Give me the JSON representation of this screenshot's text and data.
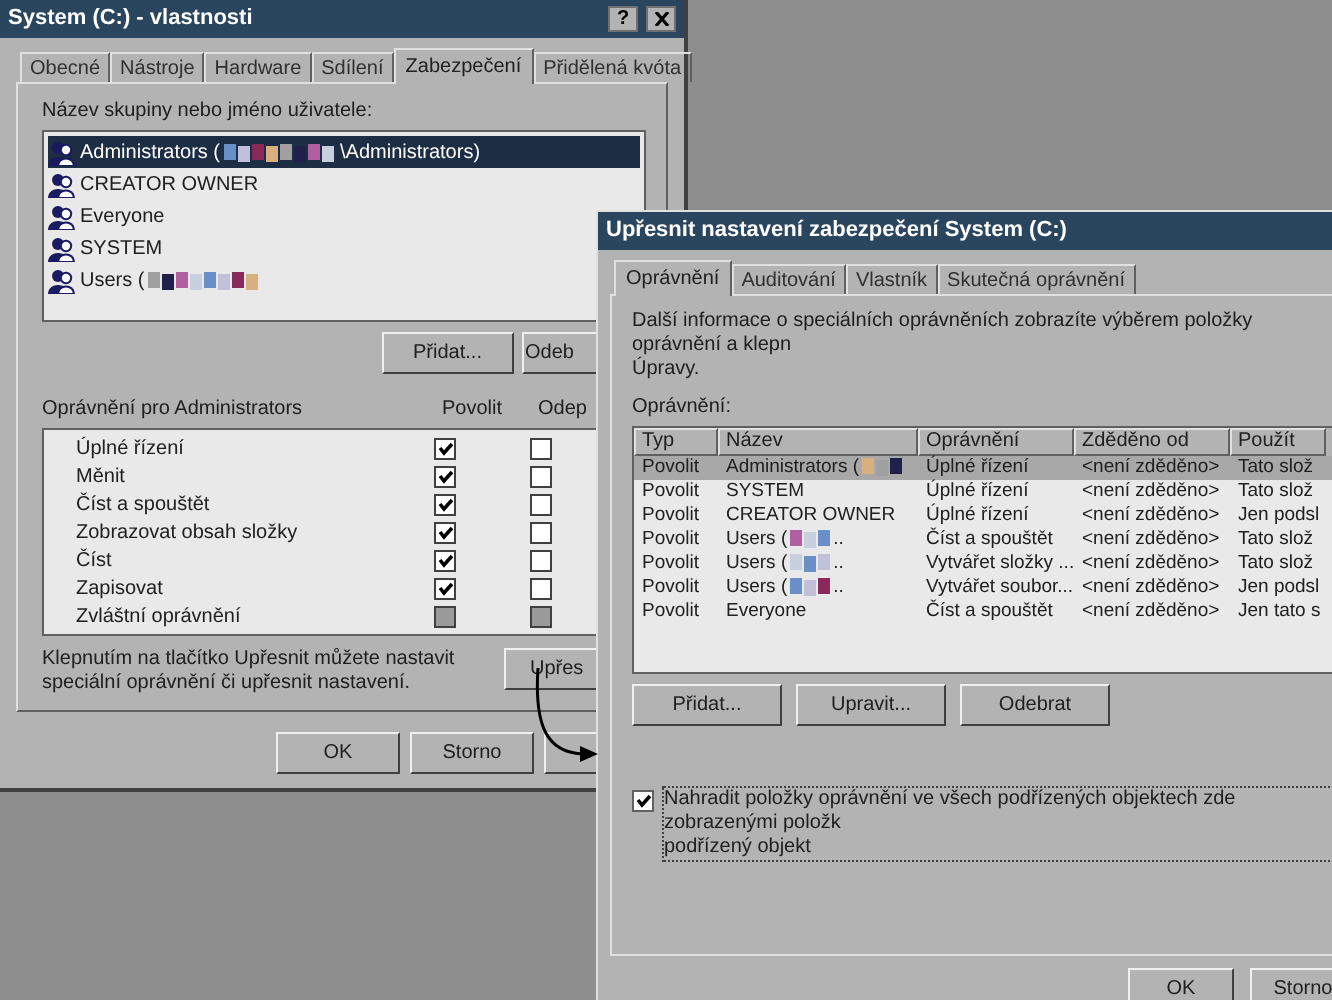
{
  "properties_window": {
    "title": "System (C:) - vlastnosti",
    "help_button": "?",
    "tabs": [
      {
        "label": "Obecné",
        "selected": false
      },
      {
        "label": "Nástroje",
        "selected": false
      },
      {
        "label": "Hardware",
        "selected": false
      },
      {
        "label": "Sdílení",
        "selected": false
      },
      {
        "label": "Zabezpečení",
        "selected": true
      },
      {
        "label": "Přidělená kvóta",
        "selected": false
      }
    ],
    "users_label": "Název skupiny nebo jméno uživatele:",
    "users": [
      {
        "name": "Administrators (",
        "redacted": true,
        "suffix": "\\Administrators)",
        "selected": true
      },
      {
        "name": "CREATOR OWNER",
        "redacted": false,
        "selected": false
      },
      {
        "name": "Everyone",
        "redacted": false,
        "selected": false
      },
      {
        "name": "SYSTEM",
        "redacted": false,
        "selected": false
      },
      {
        "name": "Users (",
        "redacted": true,
        "selected": false
      }
    ],
    "user_buttons": [
      "Přidat...",
      "Odeb"
    ],
    "permissions_label": "Oprávnění pro Administrators",
    "allow_header": "Povolit",
    "deny_header": "Odep",
    "permissions": [
      {
        "label": "Úplné řízení",
        "allow": true,
        "deny": false,
        "disabled": false
      },
      {
        "label": "Měnit",
        "allow": true,
        "deny": false,
        "disabled": false
      },
      {
        "label": "Číst a spouštět",
        "allow": true,
        "deny": false,
        "disabled": false
      },
      {
        "label": "Zobrazovat obsah složky",
        "allow": true,
        "deny": false,
        "disabled": false
      },
      {
        "label": "Číst",
        "allow": true,
        "deny": false,
        "disabled": false
      },
      {
        "label": "Zapisovat",
        "allow": true,
        "deny": false,
        "disabled": false
      },
      {
        "label": "Zvláštní oprávnění",
        "allow": false,
        "deny": false,
        "disabled": true
      }
    ],
    "hint": "Klepnutím na tlačítko Upřesnit můžete nastavit speciální oprávnění či upřesnit nastavení.",
    "advanced_button": "Upřes",
    "footer_buttons": [
      "OK",
      "Storno"
    ]
  },
  "advanced_window": {
    "title": "Upřesnit nastavení zabezpečení System (C:)",
    "tabs": [
      {
        "label": "Oprávnění",
        "selected": true
      },
      {
        "label": "Auditování",
        "selected": false
      },
      {
        "label": "Vlastník",
        "selected": false
      },
      {
        "label": "Skutečná oprávnění",
        "selected": false
      }
    ],
    "description": "Další informace o speciálních oprávněních zobrazíte výběrem položky oprávnění a klepn",
    "description_line2": "Úpravy.",
    "table_label": "Oprávnění:",
    "columns": [
      "Typ",
      "Název",
      "Oprávnění",
      "Zděděno od",
      "Použít"
    ],
    "rows": [
      {
        "type": "Povolit",
        "name": "Administrators (",
        "redacted": true,
        "permission": "Úplné řízení",
        "inherited": "<není zděděno>",
        "apply": "Tato slož",
        "selected": true
      },
      {
        "type": "Povolit",
        "name": "SYSTEM",
        "redacted": false,
        "permission": "Úplné řízení",
        "inherited": "<není zděděno>",
        "apply": "Tato slož",
        "selected": false
      },
      {
        "type": "Povolit",
        "name": "CREATOR OWNER",
        "redacted": false,
        "permission": "Úplné řízení",
        "inherited": "<není zděděno>",
        "apply": "Jen podsl",
        "selected": false
      },
      {
        "type": "Povolit",
        "name": "Users (",
        "redacted": true,
        "suffix": "..",
        "permission": "Číst a spouštět",
        "inherited": "<není zděděno>",
        "apply": "Tato slož",
        "selected": false
      },
      {
        "type": "Povolit",
        "name": "Users (",
        "redacted": true,
        "suffix": "..",
        "permission": "Vytvářet složky ...",
        "inherited": "<není zděděno>",
        "apply": "Tato slož",
        "selected": false
      },
      {
        "type": "Povolit",
        "name": "Users (",
        "redacted": true,
        "suffix": "..",
        "permission": "Vytvářet soubor...",
        "inherited": "<není zděděno>",
        "apply": "Jen podsl",
        "selected": false
      },
      {
        "type": "Povolit",
        "name": "Everyone",
        "redacted": false,
        "permission": "Číst a spouštět",
        "inherited": "<není zděděno>",
        "apply": "Jen tato s",
        "selected": false
      }
    ],
    "row_buttons": [
      "Přidat...",
      "Upravit...",
      "Odebrat"
    ],
    "replace_option": {
      "label": "Nahradit položky oprávnění ve všech podřízených objektech zde zobrazenými položk",
      "label_line2": "podřízený objekt",
      "checked": true
    },
    "footer_buttons": [
      "OK",
      "Storno"
    ]
  }
}
